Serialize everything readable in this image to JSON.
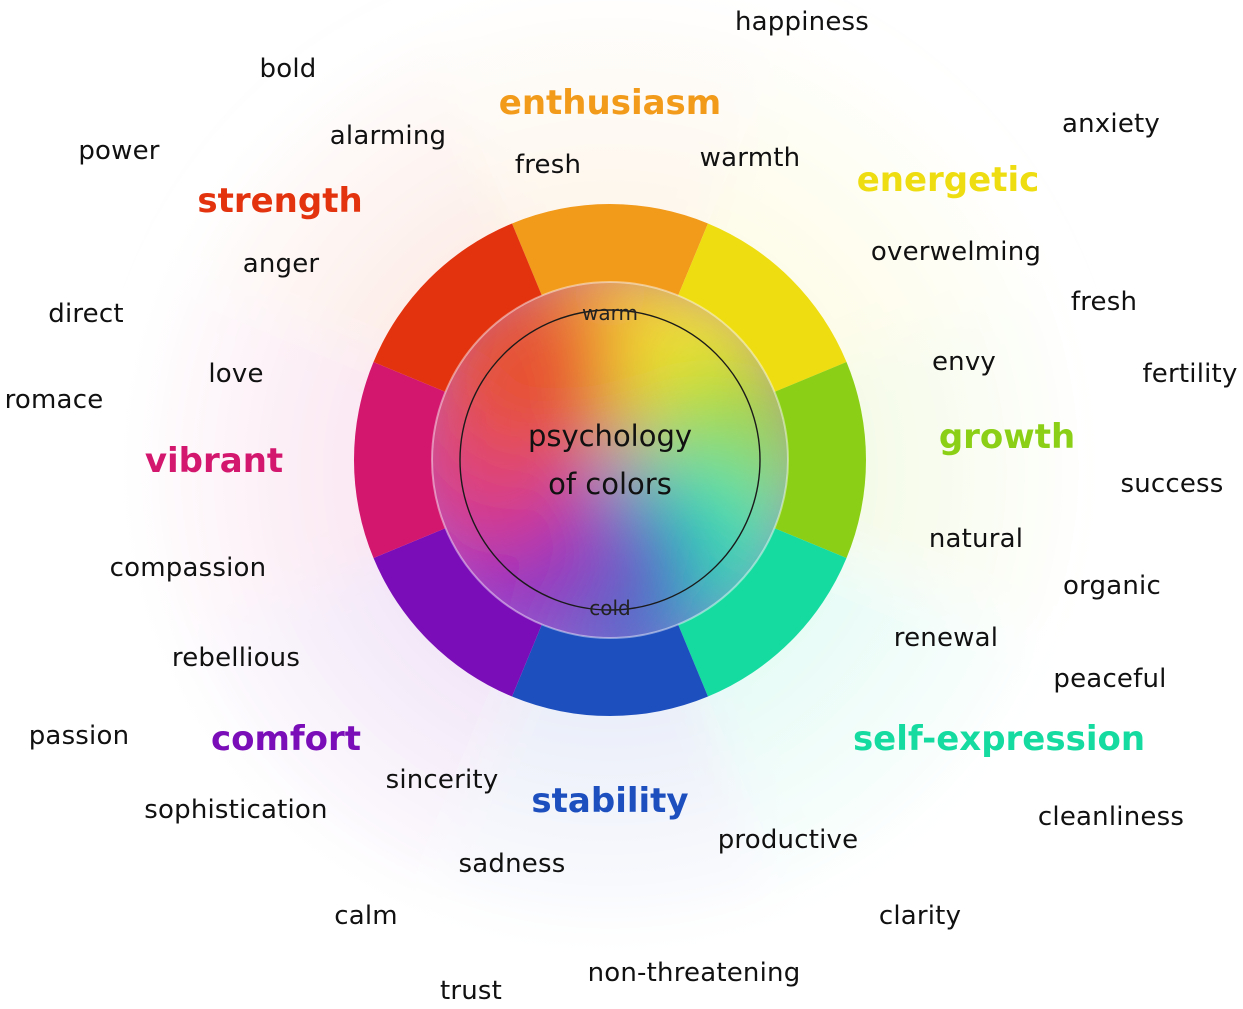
{
  "center": {
    "title_line1": "psychology",
    "title_line2": "of colors",
    "warm_label": "warm",
    "cold_label": "cold"
  },
  "categories": [
    {
      "label": "enthusiasm",
      "color": "#F29A1A"
    },
    {
      "label": "energetic",
      "color": "#EEDD10"
    },
    {
      "label": "growth",
      "color": "#8BD016"
    },
    {
      "label": "self-expression",
      "color": "#16DBA0"
    },
    {
      "label": "stability",
      "color": "#1D4FBF"
    },
    {
      "label": "comfort",
      "color": "#7A0DB8"
    },
    {
      "label": "vibrant",
      "color": "#D3166E"
    },
    {
      "label": "strength",
      "color": "#E3320E"
    }
  ],
  "words": {
    "happiness": "happiness",
    "bold": "bold",
    "alarming": "alarming",
    "power": "power",
    "fresh_top": "fresh",
    "warmth": "warmth",
    "anxiety": "anxiety",
    "anger": "anger",
    "overwelming": "overwelming",
    "direct": "direct",
    "fresh_right": "fresh",
    "envy": "envy",
    "love": "love",
    "fertility": "fertility",
    "romace": "romace",
    "success": "success",
    "compassion": "compassion",
    "natural": "natural",
    "organic": "organic",
    "rebellious": "rebellious",
    "renewal": "renewal",
    "peaceful": "peaceful",
    "passion": "passion",
    "sincerity": "sincerity",
    "sophistication": "sophistication",
    "cleanliness": "cleanliness",
    "productive": "productive",
    "sadness": "sadness",
    "calm": "calm",
    "clarity": "clarity",
    "non_threatening": "non-threatening",
    "trust": "trust"
  }
}
